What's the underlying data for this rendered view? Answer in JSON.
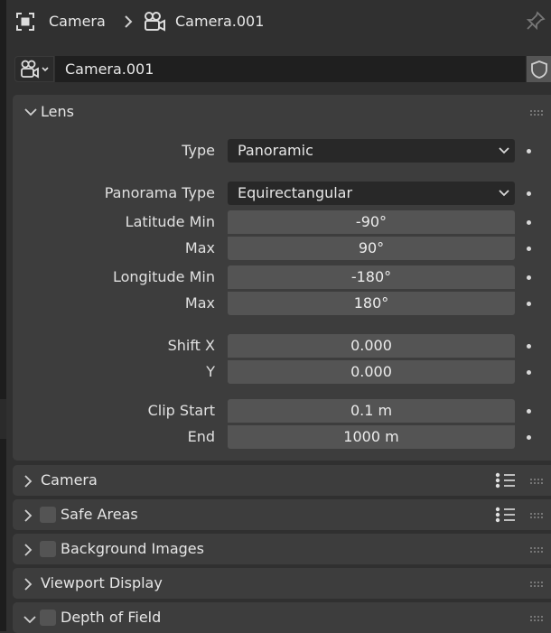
{
  "header": {
    "breadcrumb_object": "Camera",
    "breadcrumb_data": "Camera.001"
  },
  "datablock": {
    "name": "Camera.001"
  },
  "lens": {
    "title": "Lens",
    "type_label": "Type",
    "type_value": "Panoramic",
    "panorama_type_label": "Panorama Type",
    "panorama_type_value": "Equirectangular",
    "latitude_min_label": "Latitude Min",
    "latitude_min_value": "-90°",
    "latitude_max_label": "Max",
    "latitude_max_value": "90°",
    "longitude_min_label": "Longitude Min",
    "longitude_min_value": "-180°",
    "longitude_max_label": "Max",
    "longitude_max_value": "180°",
    "shift_x_label": "Shift X",
    "shift_x_value": "0.000",
    "shift_y_label": "Y",
    "shift_y_value": "0.000",
    "clip_start_label": "Clip Start",
    "clip_start_value": "0.1 m",
    "clip_end_label": "End",
    "clip_end_value": "1000 m"
  },
  "subpanels": {
    "camera": "Camera",
    "safe_areas": "Safe Areas",
    "background_images": "Background Images",
    "viewport_display": "Viewport Display",
    "depth_of_field": "Depth of Field"
  },
  "icons": {
    "object": "object-icon",
    "camera_data": "camera-data-icon",
    "pin": "pin-icon",
    "fake_user": "shield-icon",
    "presets": "list-icon",
    "drag": "grip-icon"
  },
  "colors": {
    "background": "#303030",
    "panel": "#3d3d3d",
    "field": "#545454",
    "dropdown": "#282828",
    "text": "#e6e6e6"
  }
}
